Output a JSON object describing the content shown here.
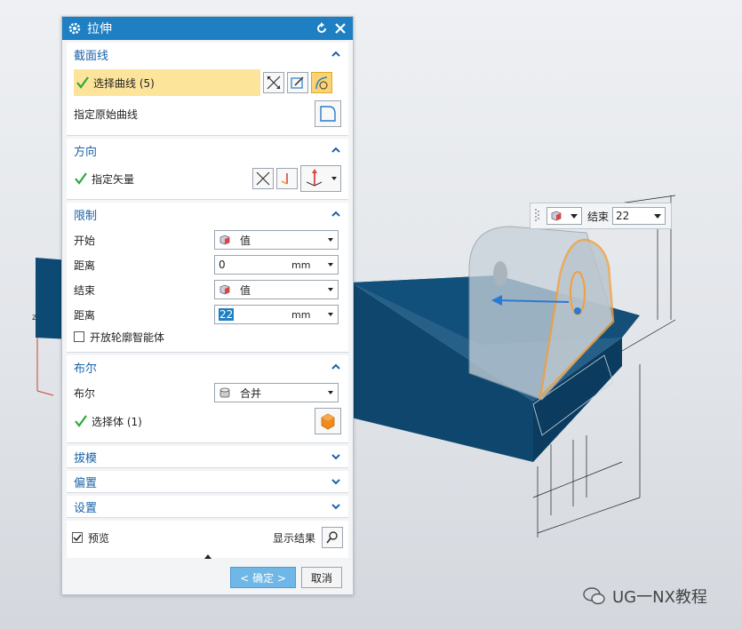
{
  "dialog": {
    "title": "拉伸",
    "section_curve": {
      "header": "截面线",
      "select_curve_label": "选择曲线 (5)",
      "original_curve_label": "指定原始曲线"
    },
    "section_direction": {
      "header": "方向",
      "vector_label": "指定矢量"
    },
    "section_limits": {
      "header": "限制",
      "start_label": "开始",
      "start_value": "值",
      "start_distance_label": "距离",
      "start_distance": "0",
      "start_unit": "mm",
      "end_label": "结束",
      "end_value": "值",
      "end_distance_label": "距离",
      "end_distance": "22",
      "end_unit": "mm",
      "open_profile_label": "开放轮廓智能体"
    },
    "section_boolean": {
      "header": "布尔",
      "boolean_label": "布尔",
      "boolean_value": "合并",
      "select_body_label": "选择体 (1)"
    },
    "section_draft": {
      "header": "拔模"
    },
    "section_offset": {
      "header": "偏置"
    },
    "section_settings": {
      "header": "设置"
    },
    "preview_label": "预览",
    "show_result_label": "显示结果",
    "ok_label": "< 确定 >",
    "cancel_label": "取消"
  },
  "mini_toolbar": {
    "end_label": "结束",
    "end_value": "22"
  },
  "watermark": {
    "text": "UG一NX教程"
  },
  "colors": {
    "title_bar": "#1e7fc3",
    "section_header_text": "#1b63a8",
    "selection_highlight": "#fde49b",
    "part_blue": "#0d4a73",
    "profile_orange": "#f0a040"
  }
}
